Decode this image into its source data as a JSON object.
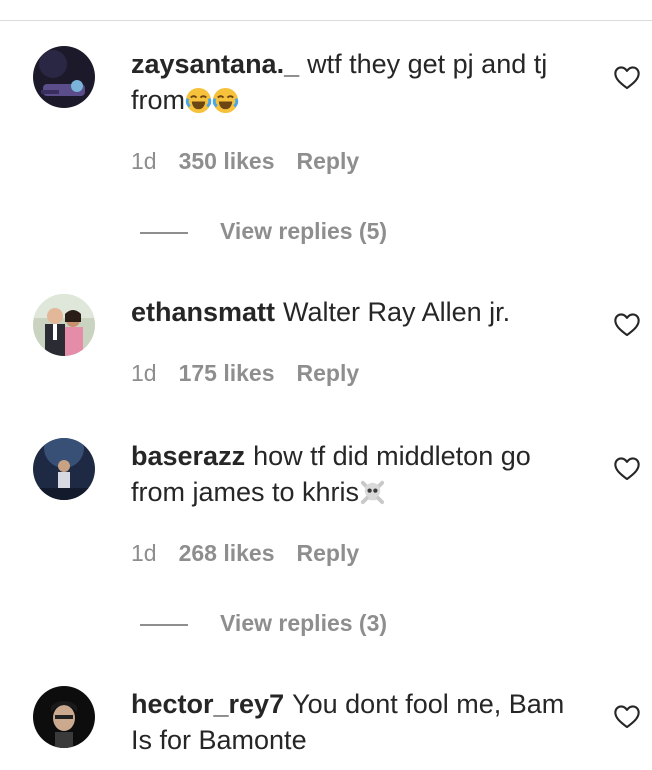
{
  "comments": [
    {
      "username": "zaysantana._",
      "text": "wtf they get pj and tj from",
      "emojis": [
        "joy-emoji",
        "joy-emoji"
      ],
      "time": "1d",
      "likes": "350 likes",
      "reply": "Reply",
      "view_replies": "View replies (5)"
    },
    {
      "username": "ethansmatt",
      "text": "Walter Ray Allen jr.",
      "emojis": [],
      "time": "1d",
      "likes": "175 likes",
      "reply": "Reply",
      "view_replies": ""
    },
    {
      "username": "baserazz",
      "text": "how tf did middleton go from james to khris",
      "emojis": [
        "skull-crossbones-emoji"
      ],
      "time": "1d",
      "likes": "268 likes",
      "reply": "Reply",
      "view_replies": "View replies (3)"
    },
    {
      "username": "hector_rey7",
      "text": "You dont fool me, Bam Is for Bamonte",
      "emojis": [],
      "time": "",
      "likes": "",
      "reply": "",
      "view_replies": ""
    }
  ],
  "icons": {
    "like": "heart-outline-icon"
  },
  "colors": {
    "text": "#262626",
    "secondary": "#8e8e8e",
    "divider": "#dbdbdb"
  }
}
